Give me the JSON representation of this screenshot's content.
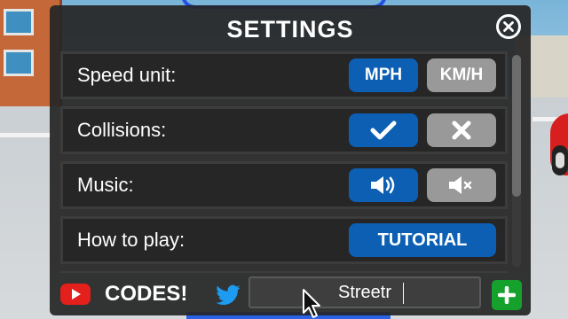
{
  "window": {
    "title": "SETTINGS",
    "close_icon": "close-circle-icon"
  },
  "settings": [
    {
      "id": "speed-unit",
      "label": "Speed unit:",
      "options": [
        {
          "label": "MPH",
          "selected": true
        },
        {
          "label": "KM/H",
          "selected": false
        }
      ]
    },
    {
      "id": "collisions",
      "label": "Collisions:",
      "options": [
        {
          "icon": "checkmark-icon",
          "selected": true
        },
        {
          "icon": "x-icon",
          "selected": false
        }
      ]
    },
    {
      "id": "music",
      "label": "Music:",
      "options": [
        {
          "icon": "speaker-on-icon",
          "selected": true
        },
        {
          "icon": "speaker-muted-icon",
          "selected": false
        }
      ]
    },
    {
      "id": "how-to-play",
      "label": "How to play:",
      "button_label": "TUTORIAL"
    }
  ],
  "codes": {
    "label": "CODES!",
    "input_value": "Streetr",
    "youtube_icon": "youtube-icon",
    "twitter_icon": "twitter-bird-icon",
    "add_icon": "plus-icon"
  },
  "colors": {
    "panel_bg": "#262626",
    "selected_button": "#0d5fb3",
    "unselected_button": "#999999",
    "add_button": "#15a12b",
    "youtube_red": "#e3201b",
    "twitter_blue": "#1d9bf0"
  }
}
